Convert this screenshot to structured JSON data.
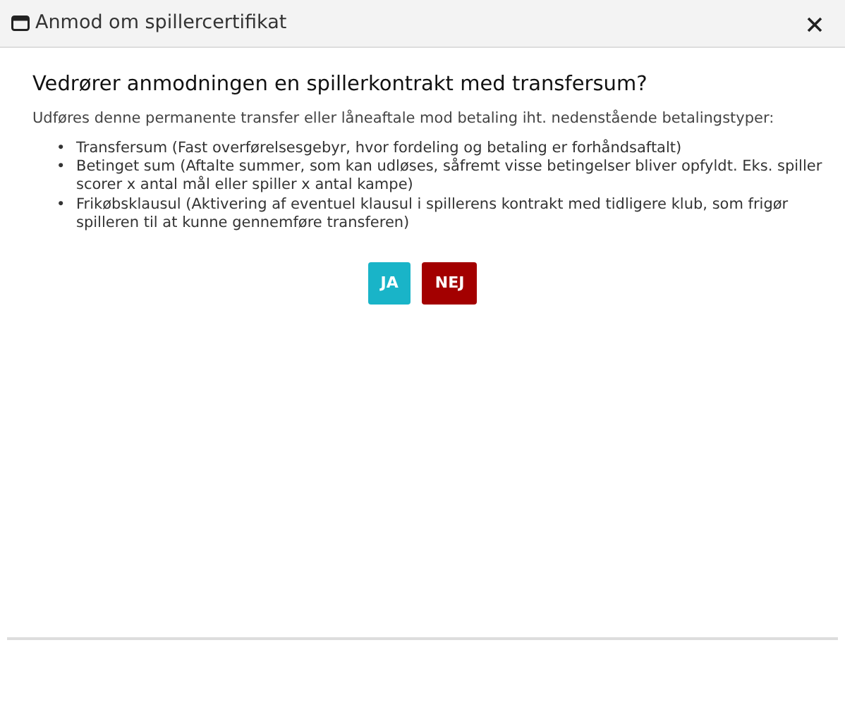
{
  "window": {
    "title": "Anmod om spillercertifikat"
  },
  "question": "Vedrører anmodningen en spillerkontrakt med transfersum?",
  "intro": "Udføres denne permanente transfer eller låneaftale mod betaling iht. nedenstående betalingstyper:",
  "payment_types": [
    {
      "bullet": "•",
      "text": "Transfersum (Fast overførelsesgebyr, hvor fordeling og betaling er forhåndsaftalt)"
    },
    {
      "bullet": "•",
      "text": "Betinget sum (Aftalte summer, som kan udløses, såfremt visse betingelser bliver opfyldt. Eks. spiller scorer x antal mål eller spiller x antal kampe)"
    },
    {
      "bullet": "•",
      "text": "Frikøbsklausul (Aktivering af eventuel klausul i spillerens kontrakt med tidligere klub, som frigør spilleren til at kunne gennemføre transferen)"
    }
  ],
  "buttons": [
    {
      "label": "JA",
      "kind": "confirm"
    },
    {
      "label": "NEJ",
      "kind": "cancel"
    }
  ]
}
